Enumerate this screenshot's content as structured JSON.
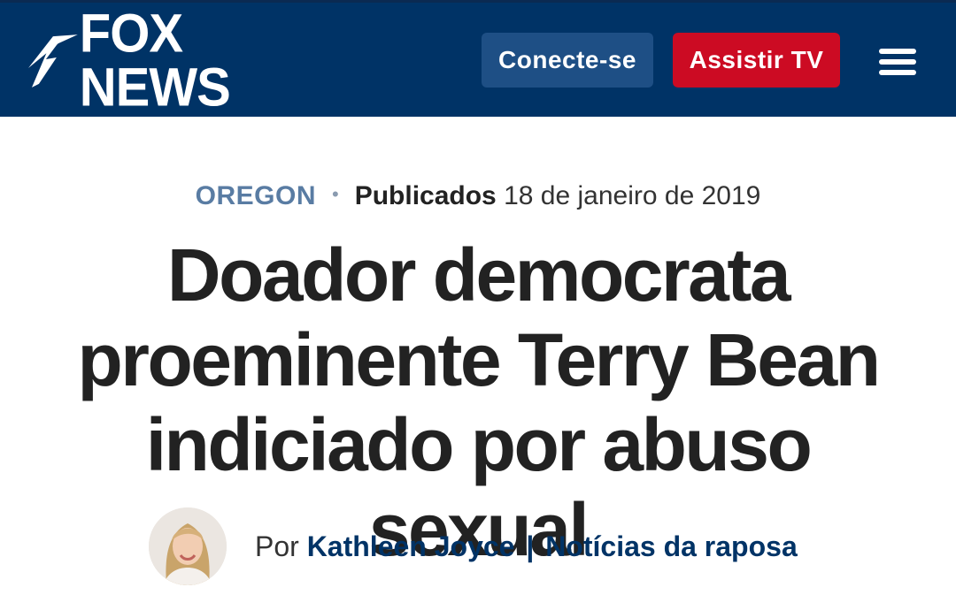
{
  "header": {
    "logo_text": "FOX NEWS",
    "login_label": "Conecte-se",
    "watch_label": "Assistir TV",
    "menu_icon": "hamburger-menu-icon",
    "colors": {
      "bar": "#003366",
      "login": "#1e4f85",
      "watch": "#cc0b23"
    }
  },
  "article": {
    "category": "OREGON",
    "separator": "•",
    "published_label": "Publicados",
    "published_date": "18 de janeiro de 2019",
    "headline": "Doador democrata proeminente Terry Bean indiciado por abuso sexual",
    "byline": {
      "prefix": "Por",
      "author": "Kathleen Joyce",
      "separator": "|",
      "source": "Notícias da raposa"
    }
  }
}
